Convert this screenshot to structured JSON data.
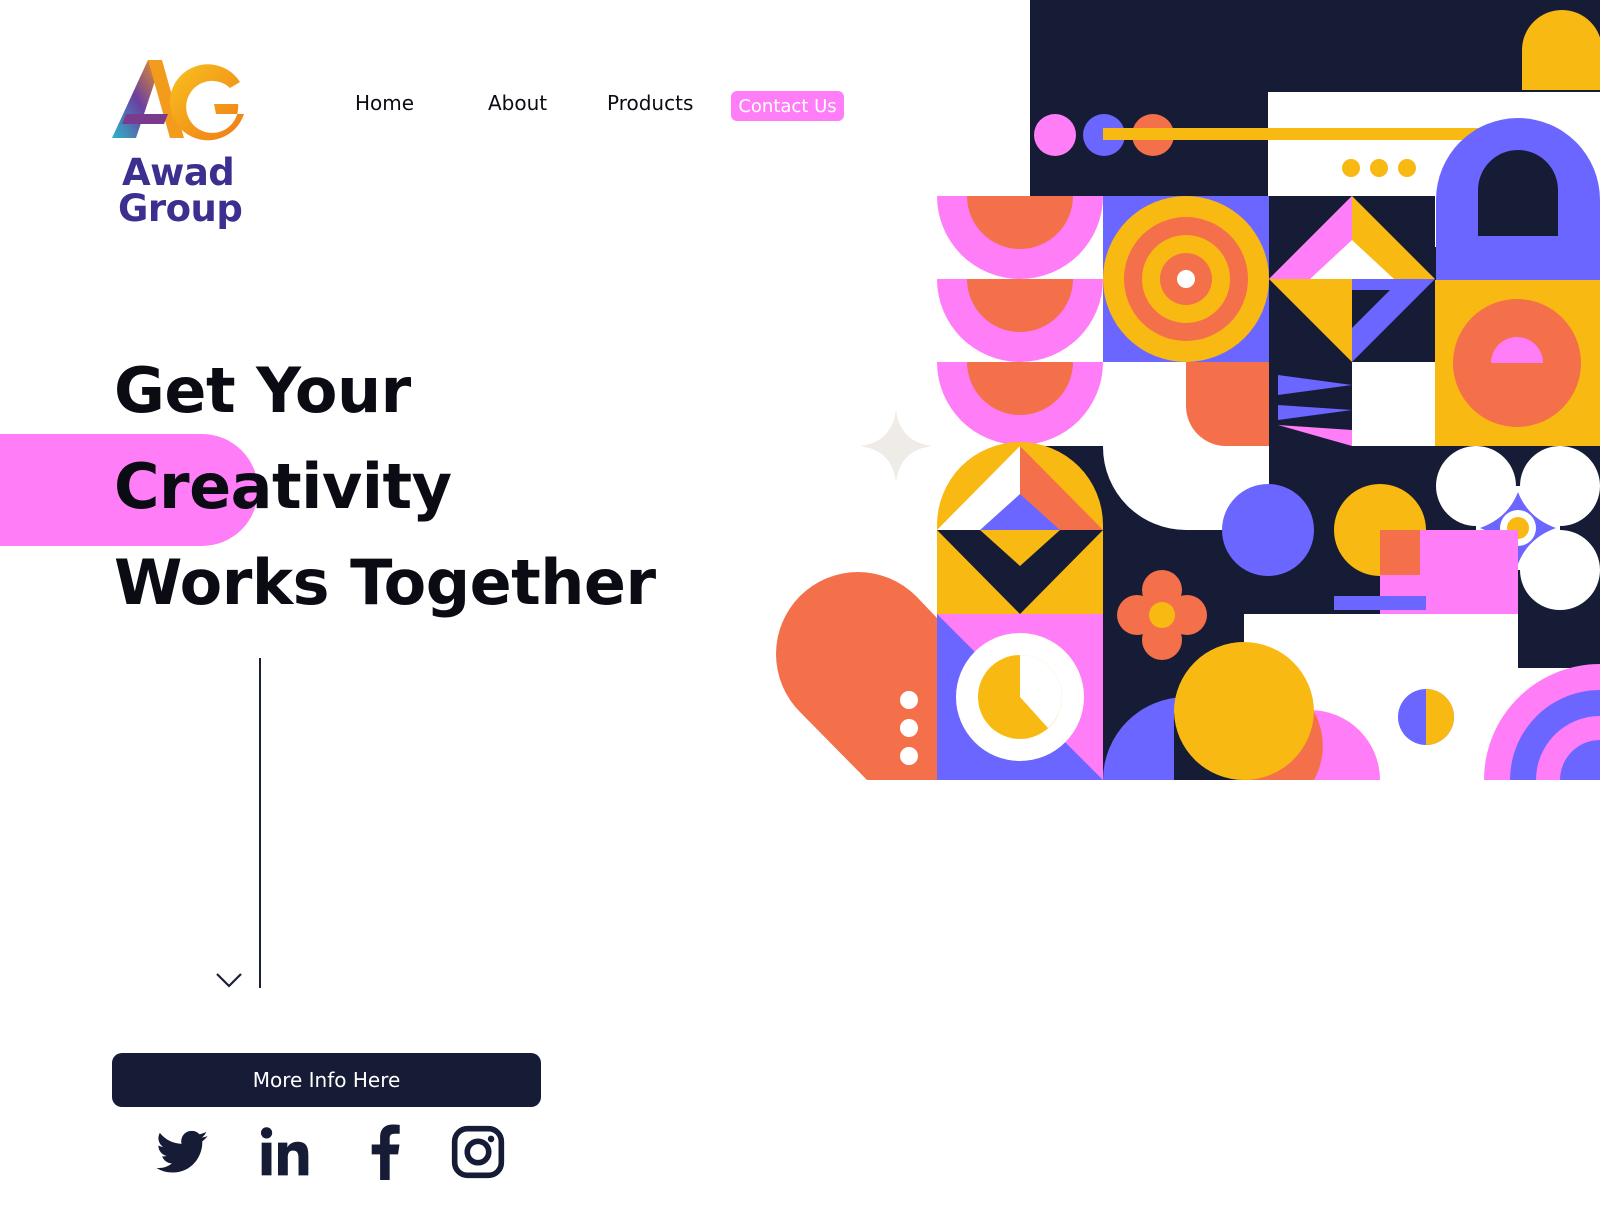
{
  "brand": {
    "line1": "Awad",
    "line2": "Group",
    "logo_icon": "ag-monogram-icon"
  },
  "nav": {
    "home": "Home",
    "about": "About",
    "products": "Products",
    "contact": "Contact Us"
  },
  "hero": {
    "line1": "Get Your",
    "line2": "Creativity",
    "line3": "Works Together"
  },
  "cta": {
    "label": "More Info Here"
  },
  "social": [
    "twitter-icon",
    "linkedin-icon",
    "facebook-icon",
    "instagram-icon"
  ],
  "colors": {
    "navy": "#161b36",
    "pink": "#ff7ef8",
    "orange": "#f4704a",
    "yellow": "#f8b912",
    "violet": "#6b66ff",
    "white": "#ffffff"
  }
}
